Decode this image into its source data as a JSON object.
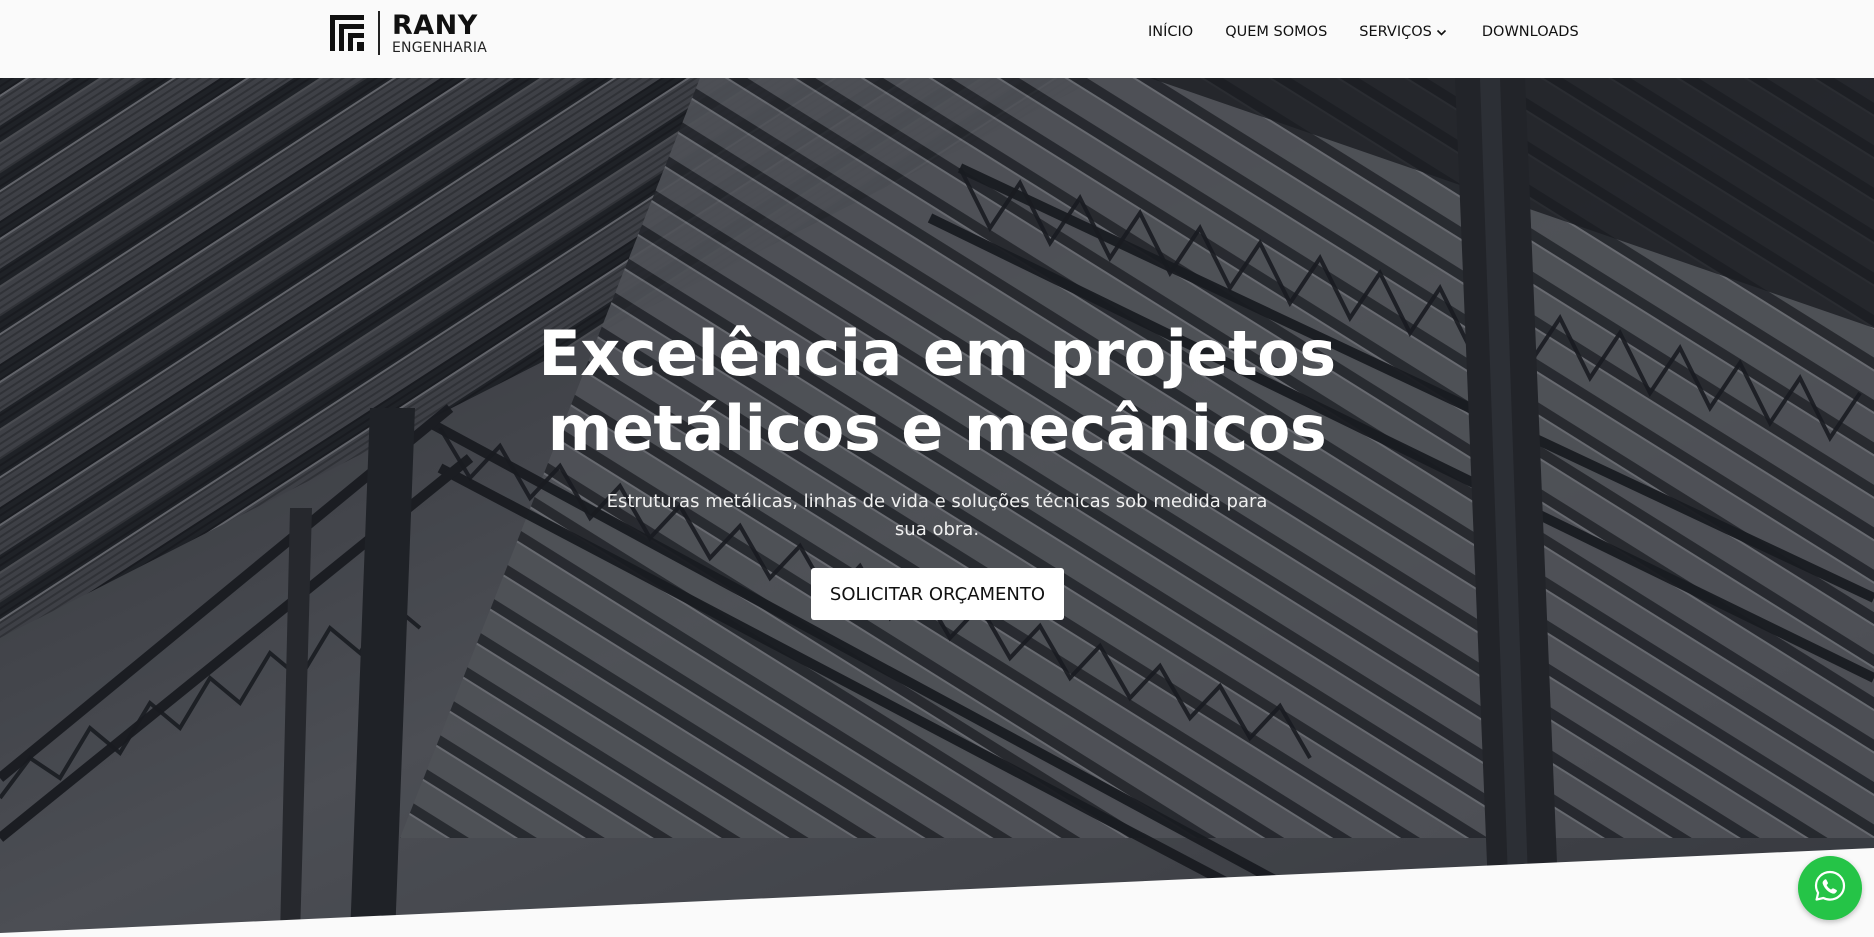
{
  "header": {
    "logo": {
      "name": "RANY",
      "sub": "ENGENHARIA"
    },
    "nav": [
      {
        "label": "INÍCIO"
      },
      {
        "label": "QUEM SOMOS"
      },
      {
        "label": "SERVIÇOS",
        "has_dropdown": true
      },
      {
        "label": "DOWNLOADS"
      }
    ]
  },
  "hero": {
    "title_line1": "Excelência em projetos",
    "title_line2": "metálicos e mecânicos",
    "subtitle": "Estruturas metálicas, linhas de vida e soluções técnicas sob medida para sua obra.",
    "cta_label": "SOLICITAR ORÇAMENTO"
  },
  "whatsapp": {
    "icon": "whatsapp-icon",
    "color": "#25c447"
  },
  "colors": {
    "header_bg": "#fafafa",
    "hero_overlay": "#14161c",
    "cta_bg": "#ffffff"
  }
}
